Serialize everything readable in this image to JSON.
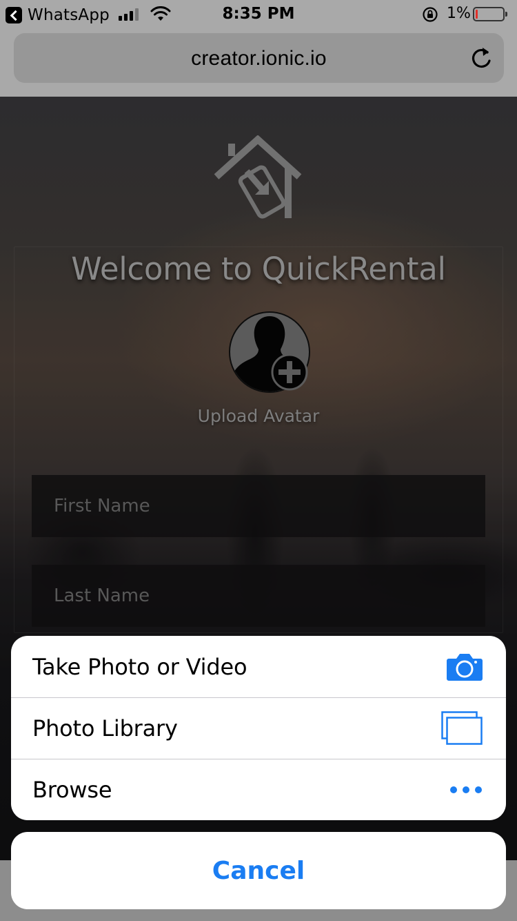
{
  "status_bar": {
    "back_app": "WhatsApp",
    "time": "8:35 PM",
    "battery": "1%"
  },
  "browser": {
    "url": "creator.ionic.io"
  },
  "page": {
    "title": "Welcome to QuickRental",
    "upload_avatar": "Upload Avatar",
    "first_name_placeholder": "First Name",
    "last_name_placeholder": "Last Name"
  },
  "action_sheet": {
    "items": [
      {
        "label": "Take Photo or Video",
        "icon": "camera-icon"
      },
      {
        "label": "Photo Library",
        "icon": "photo-library-icon"
      },
      {
        "label": "Browse",
        "icon": "more-dots-icon"
      }
    ],
    "cancel_label": "Cancel"
  },
  "colors": {
    "ios_blue": "#1a7df2",
    "status_bar_bg": "#a9a9a9"
  }
}
